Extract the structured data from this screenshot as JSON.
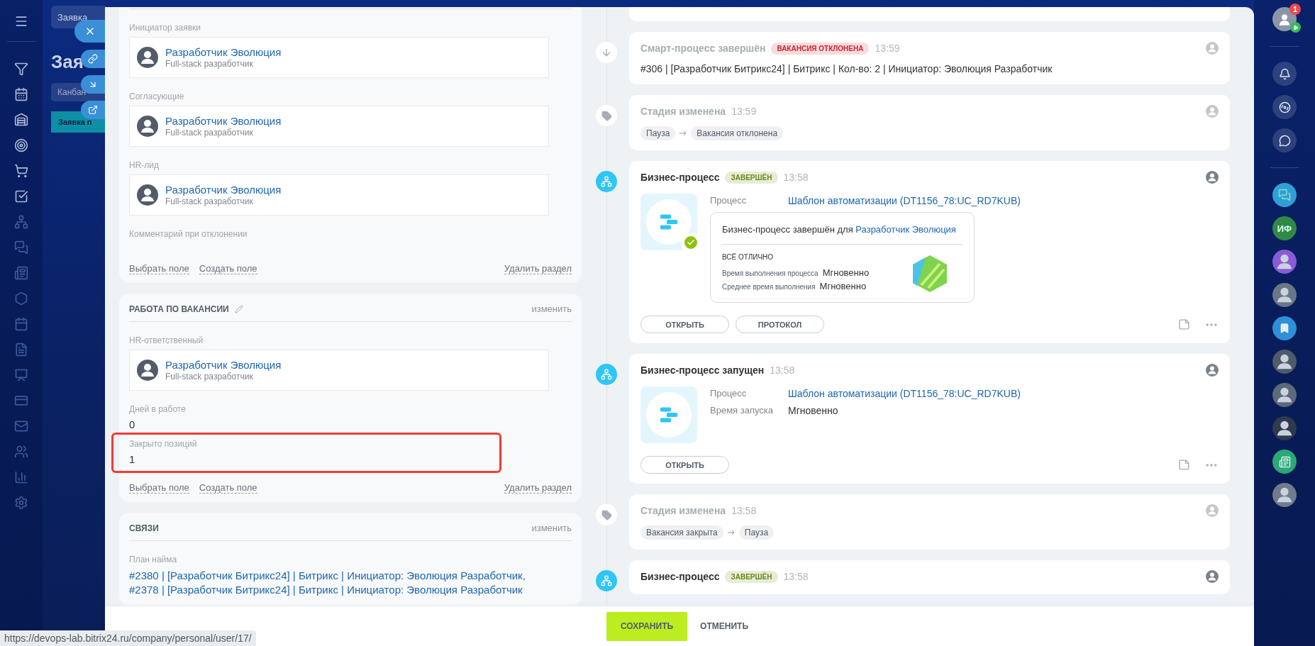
{
  "background_page": {
    "search": "Заявка",
    "title": "Зая",
    "view": "Канбан",
    "column": "Заявка п"
  },
  "sections": [
    {
      "fields": [
        {
          "kind": "user",
          "label": "Инициатор заявки",
          "name": "Разработчик Эволюция",
          "position": "Full-stack разработчик",
          "highlighted": false
        },
        {
          "kind": "user",
          "label": "Согласующие",
          "name": "Разработчик Эволюция",
          "position": "Full-stack разработчик",
          "highlighted": false
        },
        {
          "kind": "user",
          "label": "HR-лид",
          "name": "Разработчик Эволюция",
          "position": "Full-stack разработчик",
          "highlighted": false
        },
        {
          "kind": "empty",
          "label": "Комментарий при отклонении",
          "highlighted": false
        }
      ],
      "footer": {
        "select": "Выбрать поле",
        "create": "Создать поле",
        "delete": "Удалить раздел"
      }
    },
    {
      "title": "РАБОТА ПО ВАКАНСИИ",
      "editable": true,
      "action": "изменить",
      "fields": [
        {
          "kind": "user",
          "label": "HR-ответственный",
          "name": "Разработчик Эволюция",
          "position": "Full-stack разработчик",
          "highlighted": false
        },
        {
          "kind": "value",
          "label": "Дней в работе",
          "value": "0",
          "highlighted": false
        },
        {
          "kind": "value",
          "label": "Закрыто позиций",
          "value": "1",
          "highlighted": true
        }
      ],
      "footer": {
        "select": "Выбрать поле",
        "create": "Создать поле",
        "delete": "Удалить раздел"
      }
    },
    {
      "title": "СВЯЗИ",
      "editable": false,
      "action": "изменить",
      "fields": [
        {
          "kind": "links",
          "label": "План найма",
          "links": [
            "#2380 | [Разработчик Битрикс24] | Битрикс | Инициатор: Эволюция Разработчик,",
            "#2378 | [Разработчик Битрикс24] | Битрикс | Инициатор: Эволюция Разработчик"
          ],
          "highlighted": false
        }
      ]
    }
  ],
  "timeline": [
    {
      "kind": "cut"
    },
    {
      "kind": "smart",
      "title": "Смарт-процесс завершён",
      "badge": {
        "text": "ВАКАНСИЯ ОТКЛОНЕНА",
        "color": "#d0222c"
      },
      "time": "13:59",
      "text": "#306 | [Разработчик Битрикс24] | Битрикс | Кол-во: 2 | Инициатор: Эволюция Разработчик"
    },
    {
      "kind": "stage",
      "title": "Стадия изменена",
      "time": "13:59",
      "from": "Пауза",
      "to": "Вакансия отклонена"
    },
    {
      "kind": "bp_result",
      "title": "Бизнес-процесс",
      "badge": {
        "text": "ЗАВЕРШЁН",
        "color": "#6a8a10"
      },
      "time": "13:58",
      "done": true,
      "rows": [
        {
          "label": "Процесс",
          "value": "Шаблон автоматизации (DT1156_78:UC_RD7KUB)",
          "link": true
        }
      ],
      "result": {
        "message": "Бизнес-процесс завершён для",
        "user": "Разработчик Эволюция",
        "status": "ВСЁ ОТЛИЧНО",
        "stats": [
          {
            "label": "Время выполнения процесса",
            "value": "Мгновенно"
          },
          {
            "label": "Среднее время выполнения",
            "value": "Мгновенно"
          }
        ]
      },
      "buttons": [
        "ОТКРЫТЬ",
        "ПРОТОКОЛ"
      ]
    },
    {
      "kind": "bp_started",
      "title": "Бизнес-процесс запущен",
      "time": "13:58",
      "done": false,
      "rows": [
        {
          "label": "Процесс",
          "value": "Шаблон автоматизации (DT1156_78:UC_RD7KUB)",
          "link": true
        },
        {
          "label": "Время запуска",
          "value": "Мгновенно",
          "link": false
        }
      ],
      "buttons": [
        "ОТКРЫТЬ"
      ]
    },
    {
      "kind": "stage",
      "title": "Стадия изменена",
      "time": "13:58",
      "from": "Вакансия закрыта",
      "to": "Пауза"
    },
    {
      "kind": "bp_result",
      "title": "Бизнес-процесс",
      "badge": {
        "text": "ЗАВЕРШЁН",
        "color": "#6a8a10"
      },
      "time": "13:58"
    }
  ],
  "footer": {
    "save": "СОХРАНИТЬ",
    "cancel": "ОТМЕНИТЬ"
  },
  "right_bar": {
    "counter": "1",
    "contacts": [
      {
        "kind": "chat"
      },
      {
        "kind": "initials",
        "text": "ИФ"
      },
      {
        "kind": "person",
        "color": "#8a5ad8"
      },
      {
        "kind": "person",
        "color": "#6b7687"
      },
      {
        "kind": "bookmark"
      },
      {
        "kind": "person",
        "color": "#4f5a6a"
      },
      {
        "kind": "person",
        "color": "#5d6878"
      },
      {
        "kind": "person",
        "color": "#2f3a4e"
      },
      {
        "kind": "document"
      },
      {
        "kind": "person",
        "color": "#707b8b"
      }
    ]
  },
  "status_url": "https://devops-lab.bitrix24.ru/company/personal/user/17/"
}
